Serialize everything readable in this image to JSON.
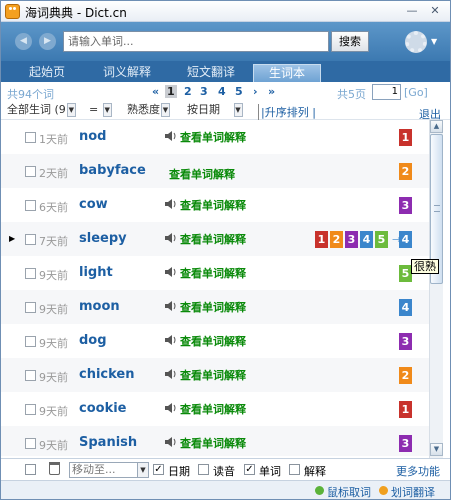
{
  "window": {
    "title": "海词典典 - Dict.cn"
  },
  "search": {
    "placeholder": "请输入单词...",
    "button_label": "搜索"
  },
  "tabs": [
    {
      "label": "起始页"
    },
    {
      "label": "词义解释"
    },
    {
      "label": "短文翻译"
    },
    {
      "label": "生词本",
      "active": true
    }
  ],
  "pager": {
    "count_text": "共94个词",
    "first": "«",
    "prev": "‹",
    "pages": [
      "1",
      "2",
      "3",
      "4",
      "5"
    ],
    "current_page": "1",
    "next": "›",
    "last": "»",
    "total_text": "共5页",
    "input_value": "1",
    "go_label": "[Go]"
  },
  "filter": {
    "category": "全部生词 (9",
    "operator": "=",
    "familiarity": "熟悉度",
    "date": "按日期",
    "sort_label": "|升序排列 |",
    "exit_label": "退出"
  },
  "view_label": "查看单词解释",
  "rows": [
    {
      "days": "1天前",
      "word": "nod",
      "level": "1"
    },
    {
      "days": "2天前",
      "word": "babyface",
      "level": "2"
    },
    {
      "days": "6天前",
      "word": "cow",
      "level": "3"
    },
    {
      "days": "7天前",
      "word": "sleepy",
      "level": "4"
    },
    {
      "days": "9天前",
      "word": "light",
      "level": "5"
    },
    {
      "days": "9天前",
      "word": "moon",
      "level": "4"
    },
    {
      "days": "9天前",
      "word": "dog",
      "level": "3"
    },
    {
      "days": "9天前",
      "word": "chicken",
      "level": "2"
    },
    {
      "days": "9天前",
      "word": "cookie",
      "level": "1"
    },
    {
      "days": "9天前",
      "word": "Spanish",
      "level": "3"
    }
  ],
  "rating_scale": [
    "1",
    "2",
    "3",
    "4",
    "5"
  ],
  "rating_arrow": "→",
  "tooltip": "很熟",
  "toolbar": {
    "move_placeholder": "移动至...",
    "date_label": "日期",
    "pron_label": "读音",
    "word_label": "单词",
    "def_label": "解释",
    "more_label": "更多功能"
  },
  "statusbar": {
    "mouse_label": "鼠标取词",
    "select_label": "划词翻译"
  },
  "colors": {
    "level_1": "#c8322c",
    "level_2": "#f08a1a",
    "level_3": "#8d2cb0",
    "level_4": "#3b86cc",
    "level_5": "#6cbb3c"
  }
}
